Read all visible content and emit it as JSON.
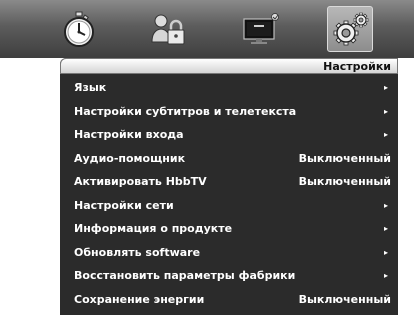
{
  "panel": {
    "title": "Настройки"
  },
  "tabs": [
    {
      "name": "timer-icon"
    },
    {
      "name": "lock-icon"
    },
    {
      "name": "tv-icon"
    },
    {
      "name": "gear-icon"
    }
  ],
  "menu": [
    {
      "label": "Язык",
      "type": "submenu",
      "arrow": "▸"
    },
    {
      "label": "Настройки субтитров и телетекста",
      "type": "submenu",
      "arrow": "▸"
    },
    {
      "label": "Настройки входа",
      "type": "submenu",
      "arrow": "▸"
    },
    {
      "label": "Аудио-помощник",
      "type": "value",
      "value": "Выключенный"
    },
    {
      "label": "Активировать HbbTV",
      "type": "value",
      "value": "Выключенный"
    },
    {
      "label": "Настройки сети",
      "type": "submenu",
      "arrow": "▸"
    },
    {
      "label": "Информация о продукте",
      "type": "submenu",
      "arrow": "▸"
    },
    {
      "label": "Обновлять software",
      "type": "submenu",
      "arrow": "▸"
    },
    {
      "label": "Восстановить параметры фабрики",
      "type": "submenu",
      "arrow": "▸"
    },
    {
      "label": "Сохранение энергии",
      "type": "value",
      "value": "Выключенный"
    }
  ],
  "colors": {
    "panel_bg": "#2b2b2b",
    "text": "#ffffff",
    "topbar": "#5c5c5c"
  }
}
